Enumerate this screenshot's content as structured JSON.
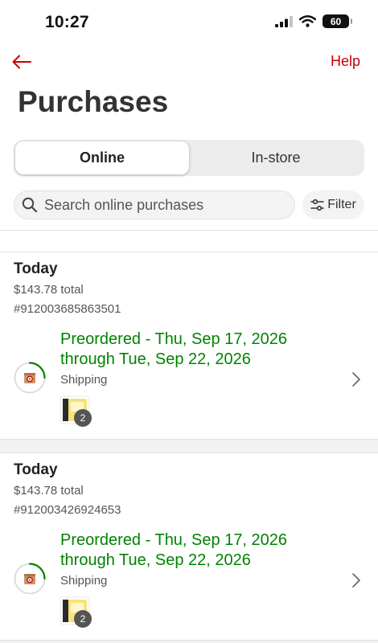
{
  "status_bar": {
    "time": "10:27",
    "battery": "60"
  },
  "nav": {
    "help_label": "Help"
  },
  "page": {
    "title": "Purchases"
  },
  "tabs": {
    "online": "Online",
    "instore": "In-store"
  },
  "search": {
    "placeholder": "Search online purchases"
  },
  "filter": {
    "label": "Filter"
  },
  "colors": {
    "brand_red": "#cc0000",
    "status_green": "#008300"
  },
  "orders": [
    {
      "date": "Today",
      "total": "$143.78 total",
      "number": "#912003685863501",
      "status": "Preordered - Thu, Sep 17, 2026 through Tue, Sep 22, 2026",
      "fulfillment": "Shipping",
      "item_count": "2"
    },
    {
      "date": "Today",
      "total": "$143.78 total",
      "number": "#912003426924653",
      "status": "Preordered - Thu, Sep 17, 2026 through Tue, Sep 22, 2026",
      "fulfillment": "Shipping",
      "item_count": "2"
    }
  ]
}
